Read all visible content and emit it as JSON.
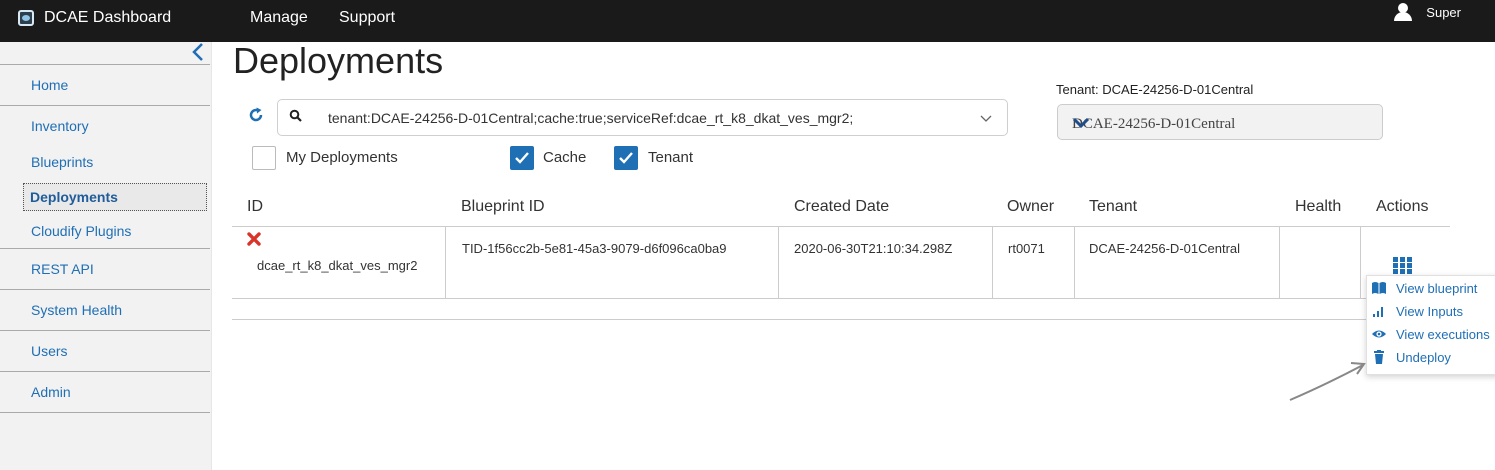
{
  "topbar": {
    "brand": "DCAE Dashboard",
    "nav": [
      {
        "label": "Manage"
      },
      {
        "label": "Support"
      }
    ],
    "user": "Super"
  },
  "sidebar": {
    "collapse_icon": "chevron-left-icon",
    "items": [
      {
        "label": "Home"
      },
      {
        "label": "Inventory"
      },
      {
        "label": "Blueprints"
      },
      {
        "label": "Deployments",
        "active": true
      },
      {
        "label": "Cloudify Plugins"
      },
      {
        "label": "REST API"
      },
      {
        "label": "System Health"
      },
      {
        "label": "Users"
      },
      {
        "label": "Admin"
      }
    ]
  },
  "main": {
    "title": "Deployments",
    "search": {
      "value": "tenant:DCAE-24256-D-01Central;cache:true;serviceRef:dcae_rt_k8_dkat_ves_mgr2;"
    },
    "tenant": {
      "label": "Tenant: DCAE-24256-D-01Central",
      "selected": "DCAE-24256-D-01Central"
    },
    "filters": [
      {
        "label": "My Deployments",
        "checked": false
      },
      {
        "label": "Cache",
        "checked": true
      },
      {
        "label": "Tenant",
        "checked": true
      }
    ]
  },
  "table": {
    "columns": [
      "ID",
      "Blueprint ID",
      "Created Date",
      "Owner",
      "Tenant",
      "Health",
      "Actions"
    ],
    "rows": [
      {
        "id": "dcae_rt_k8_dkat_ves_mgr2",
        "blueprint_id": "TID-1f56cc2b-5e81-45a3-9079-d6f096ca0ba9",
        "created": "2020-06-30T21:10:34.298Z",
        "owner": "rt0071",
        "tenant": "DCAE-24256-D-01Central",
        "health": ""
      }
    ]
  },
  "actions_menu": [
    {
      "label": "View blueprint",
      "icon": "book-icon"
    },
    {
      "label": "View Inputs",
      "icon": "bar-chart-icon"
    },
    {
      "label": "View executions",
      "icon": "eye-icon"
    },
    {
      "label": "Undeploy",
      "icon": "trash-icon"
    }
  ],
  "colors": {
    "topbar": "#1a1a1a",
    "accent": "#1f6fb5",
    "delete": "#d9342b"
  }
}
